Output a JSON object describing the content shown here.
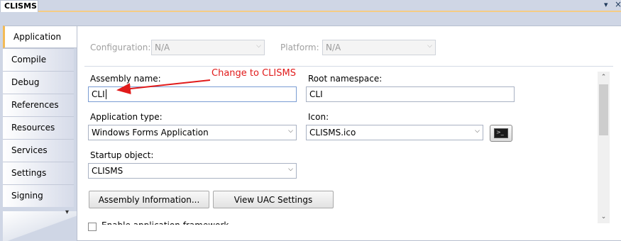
{
  "document_tab": {
    "title": "CLISMS"
  },
  "sidebar": {
    "items": [
      {
        "label": "Application",
        "active": true
      },
      {
        "label": "Compile"
      },
      {
        "label": "Debug"
      },
      {
        "label": "References"
      },
      {
        "label": "Resources"
      },
      {
        "label": "Services"
      },
      {
        "label": "Settings"
      },
      {
        "label": "Signing"
      }
    ]
  },
  "config": {
    "configuration_label": "Configuration:",
    "configuration_value": "N/A",
    "platform_label": "Platform:",
    "platform_value": "N/A"
  },
  "form": {
    "assembly_name_label": "Assembly name:",
    "assembly_name_value": "CLI",
    "root_namespace_label": "Root namespace:",
    "root_namespace_value": "CLI",
    "application_type_label": "Application type:",
    "application_type_value": "Windows Forms Application",
    "icon_label": "Icon:",
    "icon_value": "CLISMS.ico",
    "startup_object_label": "Startup object:",
    "startup_object_value": "CLISMS"
  },
  "buttons": {
    "assembly_info": "Assembly Information...",
    "view_uac": "View UAC Settings"
  },
  "checkbox": {
    "label": "Enable application framework"
  },
  "annotation": {
    "text": "Change to CLISMS",
    "color": "#e11b1b"
  },
  "colors": {
    "active_tab_accent": "#f3ba55",
    "chrome_background": "#cfd6e5"
  },
  "icons": {
    "app_icon": "console-window-icon"
  }
}
